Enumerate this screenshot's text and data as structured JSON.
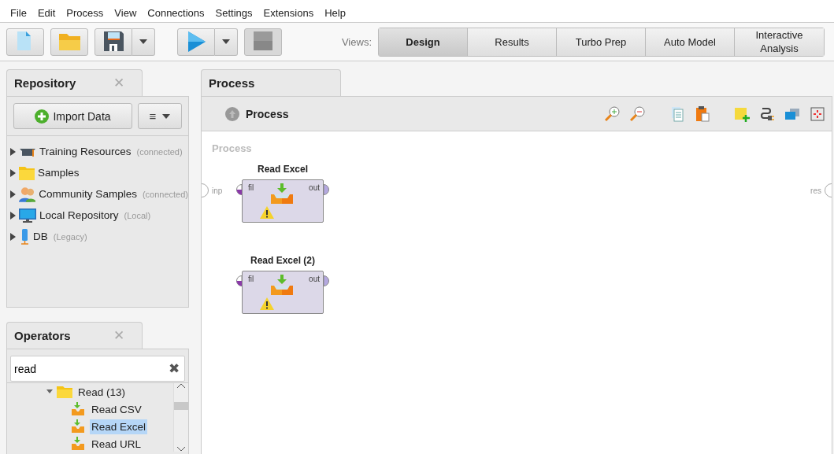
{
  "menu": [
    "File",
    "Edit",
    "Process",
    "View",
    "Connections",
    "Settings",
    "Extensions",
    "Help"
  ],
  "toolbar": {
    "buttons": [
      {
        "kind": "new",
        "dropdown": false,
        "disabled": false
      },
      {
        "kind": "open",
        "dropdown": false,
        "disabled": false
      },
      {
        "kind": "save",
        "dropdown": true,
        "disabled": false
      },
      {
        "kind": "run",
        "dropdown": true,
        "disabled": false
      },
      {
        "kind": "stop",
        "dropdown": false,
        "disabled": true
      }
    ],
    "views_label": "Views:",
    "views": [
      {
        "label": "Design",
        "selected": true
      },
      {
        "label": "Results",
        "selected": false
      },
      {
        "label": "Turbo Prep",
        "selected": false
      },
      {
        "label": "Auto Model",
        "selected": false
      },
      {
        "label": "Interactive Analysis",
        "selected": false
      }
    ]
  },
  "repository": {
    "title": "Repository",
    "close": "✕",
    "import_button": "Import Data",
    "menu_button": "≡",
    "items": [
      {
        "kind": "training",
        "label": "Training Resources",
        "note": "(connected)"
      },
      {
        "kind": "folder",
        "label": "Samples"
      },
      {
        "kind": "community",
        "label": "Community Samples",
        "note": "(connected)"
      },
      {
        "kind": "local",
        "label": "Local Repository",
        "note": "(Local)"
      },
      {
        "kind": "db",
        "label": "DB",
        "note": "(Legacy)"
      }
    ]
  },
  "operators": {
    "title": "Operators",
    "close": "✕",
    "search": {
      "value": "read",
      "clear": "✖"
    },
    "tree": [
      {
        "label": "Read (13)",
        "kind": "folder",
        "expanded": true,
        "children": [
          {
            "label": "Read CSV",
            "kind": "operator",
            "selected": false
          },
          {
            "label": "Read Excel",
            "kind": "operator",
            "selected": true
          },
          {
            "label": "Read URL",
            "kind": "operator",
            "selected": false
          }
        ]
      }
    ]
  },
  "process": {
    "tab": "Process",
    "header": "Process",
    "canvas": {
      "title": "Process",
      "input_port": "inp",
      "output_port": "res",
      "operators": [
        {
          "name": "Read Excel",
          "in_port": "fil",
          "out_port": "out",
          "in_connected": true,
          "warning": true
        },
        {
          "name": "Read Excel (2)",
          "in_port": "fil",
          "out_port": "out",
          "in_connected": true,
          "warning": true
        }
      ]
    }
  }
}
